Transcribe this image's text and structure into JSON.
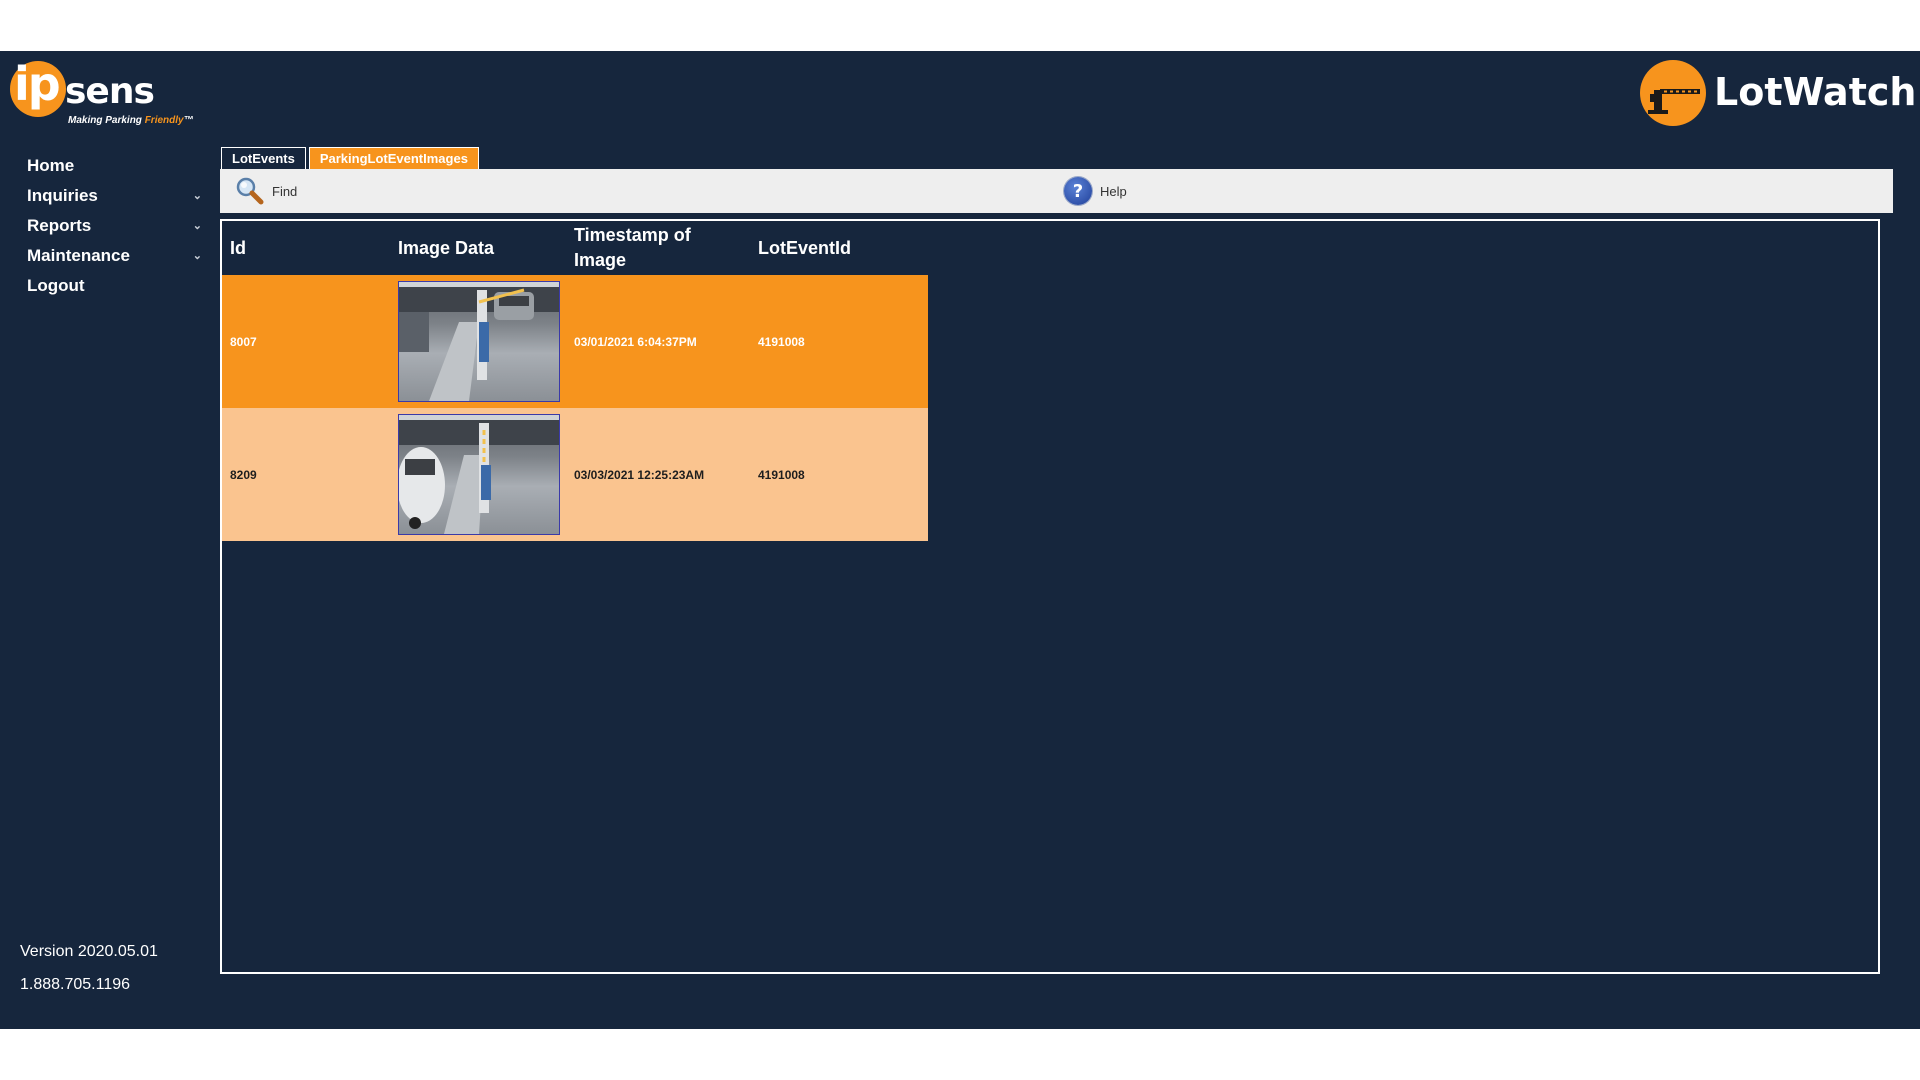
{
  "brand": {
    "left_logo_ip": "ip",
    "left_logo_sens": "sens",
    "left_tagline_a": "Making Parking ",
    "left_tagline_b": "Friendly",
    "left_tagline_tm": "™",
    "right_logo": "LotWatch",
    "accent_color": "#f7941d",
    "background_color": "#16263d"
  },
  "nav": {
    "items": [
      {
        "label": "Home",
        "has_submenu": false
      },
      {
        "label": "Inquiries",
        "has_submenu": true
      },
      {
        "label": "Reports",
        "has_submenu": true
      },
      {
        "label": "Maintenance",
        "has_submenu": true
      },
      {
        "label": "Logout",
        "has_submenu": false
      }
    ],
    "chevron": "⌄"
  },
  "footer": {
    "version": "Version 2020.05.01",
    "phone": "1.888.705.1196"
  },
  "tabs": [
    {
      "label": "LotEvents",
      "active": false
    },
    {
      "label": "ParkingLotEventImages",
      "active": true
    }
  ],
  "toolbar": {
    "find_label": "Find",
    "find_icon": "magnifier-icon",
    "help_label": "Help",
    "help_icon": "question-circle-icon",
    "help_glyph": "?"
  },
  "grid": {
    "columns": [
      "Id",
      "Image Data",
      "Timestamp of Image",
      "LotEventId"
    ],
    "rows": [
      {
        "id": "8007",
        "image": "parking-gate-camera-image",
        "timestamp": "03/01/2021 6:04:37PM",
        "lot_event_id": "4191008",
        "selected": true
      },
      {
        "id": "8209",
        "image": "parking-gate-camera-image",
        "timestamp": "03/03/2021 12:25:23AM",
        "lot_event_id": "4191008",
        "selected": false
      }
    ]
  }
}
